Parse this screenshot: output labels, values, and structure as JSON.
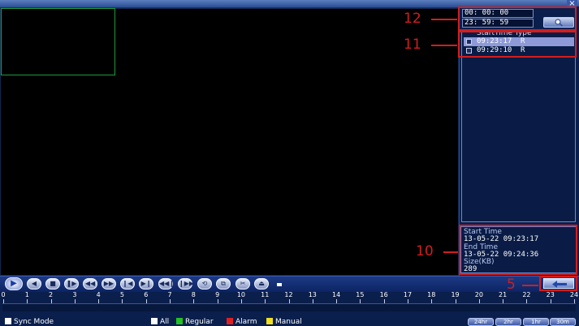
{
  "window": {
    "close_symbol": "×"
  },
  "search": {
    "start_time": "00: 00: 00",
    "end_time": "23: 59: 59",
    "button_icon": "search-icon"
  },
  "file_list": {
    "header": "StartTime Type",
    "rows": [
      {
        "time": "09:23:17",
        "type": "R",
        "selected": true
      },
      {
        "time": "09:29:10",
        "type": "R",
        "selected": false
      }
    ]
  },
  "file_info": {
    "start_label": "Start Time",
    "start_value": "13-05-22 09:23:17",
    "end_label": "End Time",
    "end_value": "13-05-22 09:24:36",
    "size_label": "Size(KB)",
    "size_value": "289"
  },
  "controls": [
    {
      "name": "play",
      "glyph": "▶"
    },
    {
      "name": "reverse",
      "glyph": "◀"
    },
    {
      "name": "stop",
      "glyph": "■"
    },
    {
      "name": "pause",
      "glyph": "❚▶"
    },
    {
      "name": "slow",
      "glyph": "◀◀"
    },
    {
      "name": "fast",
      "glyph": "▶▶"
    },
    {
      "name": "prev-frame",
      "glyph": "❙◀"
    },
    {
      "name": "next-frame",
      "glyph": "▶❙"
    },
    {
      "name": "prev-file",
      "glyph": "◀◀❙"
    },
    {
      "name": "next-file",
      "glyph": "❙▶▶"
    },
    {
      "name": "loop",
      "glyph": "⟲"
    },
    {
      "name": "fullscreen",
      "glyph": "⧉"
    },
    {
      "name": "clip",
      "glyph": "✂"
    },
    {
      "name": "backup",
      "glyph": "⏏"
    }
  ],
  "timeline": {
    "ticks": [
      "0",
      "1",
      "2",
      "3",
      "4",
      "5",
      "6",
      "7",
      "8",
      "9",
      "10",
      "11",
      "12",
      "13",
      "14",
      "15",
      "16",
      "17",
      "18",
      "19",
      "20",
      "21",
      "22",
      "23",
      "24"
    ]
  },
  "bottom": {
    "sync_mode": "Sync Mode",
    "legend": [
      {
        "label": "All",
        "color": "#ffffff"
      },
      {
        "label": "Regular",
        "color": "#22c322"
      },
      {
        "label": "Alarm",
        "color": "#e02020"
      },
      {
        "label": "Manual",
        "color": "#f2e01c"
      }
    ],
    "zoom": [
      "24hr",
      "2hr",
      "1hr",
      "30m"
    ]
  },
  "annotations": {
    "label_12": "12",
    "label_11": "11",
    "label_10": "10",
    "label_5": "5",
    "color": "#d21e1e"
  },
  "colors": {
    "panel_bg": "#0b1f4d",
    "selection": "#8e9ad8",
    "channel_border": "#1f9b3a"
  }
}
